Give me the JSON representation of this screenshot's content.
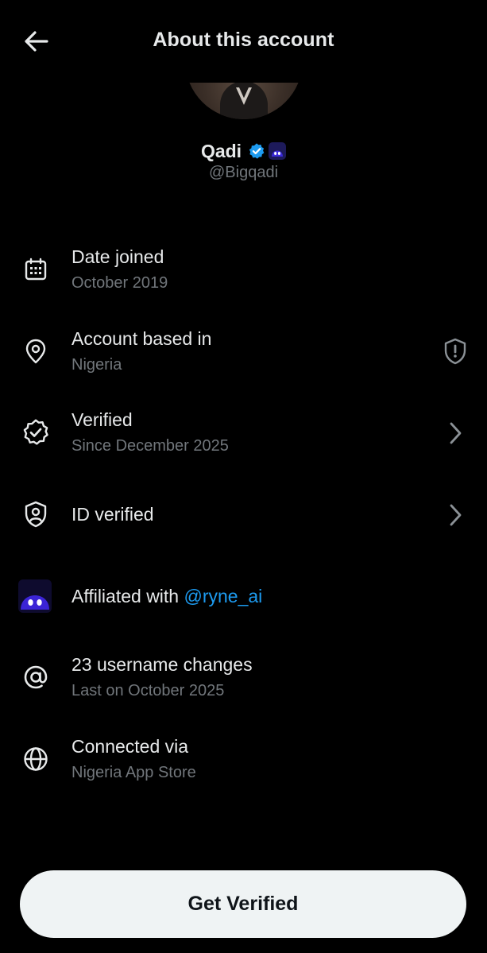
{
  "header": {
    "title": "About this account"
  },
  "profile": {
    "display_name": "Qadi",
    "handle": "@Bigqadi"
  },
  "rows": [
    {
      "title": "Date joined",
      "subtitle": "October 2019",
      "icon": "calendar-icon"
    },
    {
      "title": "Account based in",
      "subtitle": "Nigeria",
      "icon": "location-pin-icon",
      "trailing_icon": "shield-alert-icon"
    },
    {
      "title": "Verified",
      "subtitle": "Since December 2025",
      "icon": "verified-check-icon",
      "trailing_icon": "chevron-right-icon"
    },
    {
      "title": "ID verified",
      "icon": "id-shield-icon",
      "trailing_icon": "chevron-right-icon"
    },
    {
      "title_prefix": "Affiliated with ",
      "title_link": "@ryne_ai",
      "icon": "ryne-ai-logo-icon"
    },
    {
      "title": "23 username changes",
      "subtitle": "Last on October 2025",
      "icon": "at-sign-icon"
    },
    {
      "title": "Connected via",
      "subtitle": "Nigeria App Store",
      "icon": "globe-icon"
    }
  ],
  "cta": {
    "label": "Get Verified"
  },
  "colors": {
    "background": "#000000",
    "primary_text": "#e7e9ea",
    "secondary_text": "#71767b",
    "link": "#1d9bf0",
    "verified_badge": "#1d9bf0",
    "button_bg": "#eff3f4",
    "button_text": "#0f1419"
  }
}
